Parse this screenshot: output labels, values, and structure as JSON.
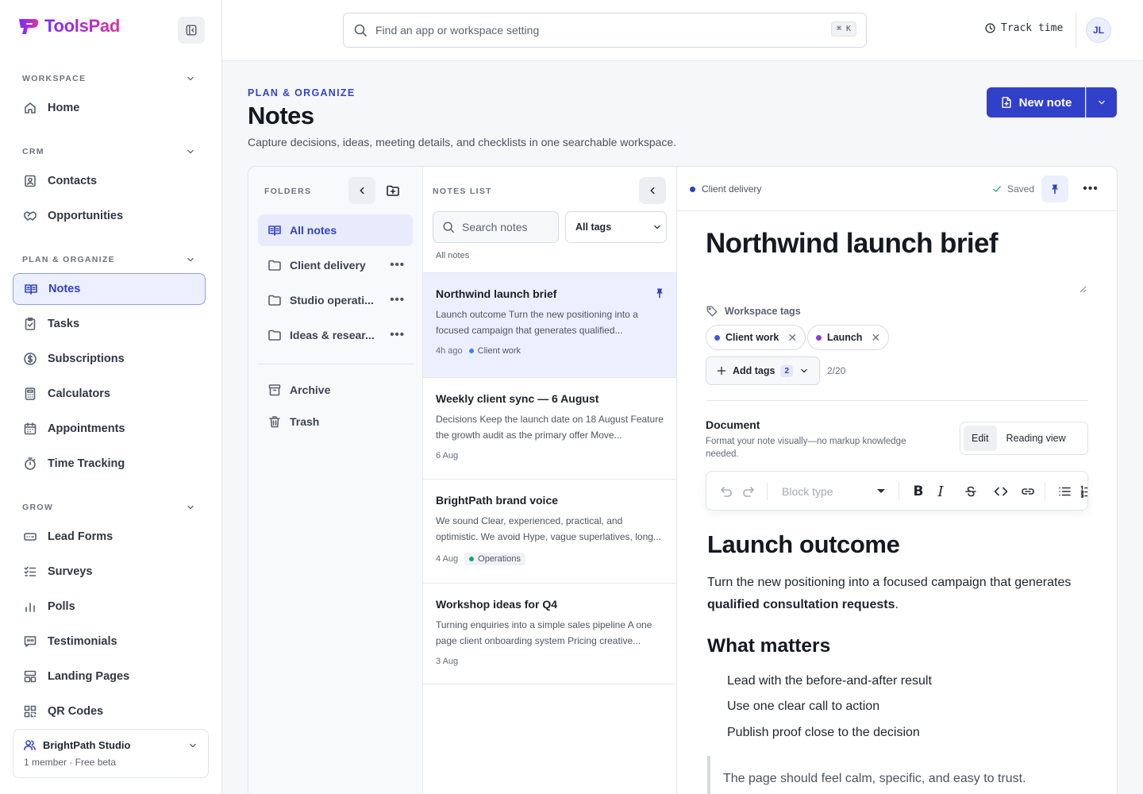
{
  "app": {
    "name": "ToolsPad"
  },
  "sidebar": {
    "sections": [
      {
        "label": "WORKSPACE"
      },
      {
        "label": "CRM"
      },
      {
        "label": "PLAN & ORGANIZE"
      },
      {
        "label": "GROW"
      }
    ],
    "items": [
      {
        "label": "Home",
        "icon": "home-icon"
      },
      {
        "label": "Contacts",
        "icon": "contacts-icon"
      },
      {
        "label": "Opportunities",
        "icon": "handshake-icon"
      },
      {
        "label": "Notes",
        "icon": "book-icon",
        "active": true
      },
      {
        "label": "Tasks",
        "icon": "clipboard-check-icon"
      },
      {
        "label": "Subscriptions",
        "icon": "dollar-circle-icon"
      },
      {
        "label": "Calculators",
        "icon": "calculator-icon"
      },
      {
        "label": "Appointments",
        "icon": "calendar-icon"
      },
      {
        "label": "Time Tracking",
        "icon": "stopwatch-icon"
      },
      {
        "label": "Lead Forms",
        "icon": "form-icon"
      },
      {
        "label": "Surveys",
        "icon": "checklist-icon"
      },
      {
        "label": "Polls",
        "icon": "bar-chart-icon"
      },
      {
        "label": "Testimonials",
        "icon": "quote-bubble-icon"
      },
      {
        "label": "Landing Pages",
        "icon": "layout-icon"
      },
      {
        "label": "QR Codes",
        "icon": "qr-icon"
      }
    ],
    "studio": {
      "name": "BrightPath Studio",
      "sub": "1 member · Free beta"
    }
  },
  "topbar": {
    "search_placeholder": "Find an app or workspace setting",
    "shortcut": "⌘ K",
    "track_label": "Track time",
    "avatar_initials": "JL"
  },
  "header": {
    "eyebrow": "PLAN & ORGANIZE",
    "title": "Notes",
    "description": "Capture decisions, ideas, meeting details, and checklists in one searchable workspace.",
    "new_note_label": "New note"
  },
  "folders": {
    "heading": "FOLDERS",
    "items": [
      {
        "label": "All notes",
        "active": true
      },
      {
        "label": "Client delivery"
      },
      {
        "label": "Studio operati..."
      },
      {
        "label": "Ideas & resear..."
      }
    ],
    "archive_label": "Archive",
    "trash_label": "Trash"
  },
  "notes_list": {
    "heading": "NOTES LIST",
    "search_placeholder": "Search notes",
    "tag_filter": "All tags",
    "scope_label": "All notes",
    "notes": [
      {
        "title": "Northwind launch brief",
        "snippet": "Launch outcome Turn the new positioning into a focused campaign that generates qualified...",
        "date": "4h ago",
        "tag": "Client work",
        "tag_color": "#3b82f6",
        "pinned": true,
        "active": true
      },
      {
        "title": "Weekly client sync — 6 August",
        "snippet": "Decisions Keep the launch date on 18 August Feature the growth audit as the primary offer Move...",
        "date": "6 Aug"
      },
      {
        "title": "BrightPath brand voice",
        "snippet": "We sound Clear, experienced, practical, and optimistic. We avoid Hype, vague superlatives, long...",
        "date": "4 Aug",
        "tag": "Operations",
        "tag_color": "#14a37f"
      },
      {
        "title": "Workshop ideas for Q4",
        "snippet": "Turning enquiries into a simple sales pipeline A one page client onboarding system Pricing creative...",
        "date": "3 Aug"
      }
    ]
  },
  "editor": {
    "folder_crumb": "Client delivery",
    "saved_label": "Saved",
    "title": "Northwind launch brief",
    "tags_label": "Workspace tags",
    "tags": [
      {
        "label": "Client work",
        "color": "#3b5bdb"
      },
      {
        "label": "Launch",
        "color": "#8b3fd1"
      }
    ],
    "add_tags_label": "Add tags",
    "add_tags_count": "2",
    "tag_limit": "2/20",
    "document_label": "Document",
    "document_desc": "Format your note visually—no markup knowledge needed.",
    "view_edit": "Edit",
    "view_reading": "Reading view",
    "block_type_placeholder": "Block type",
    "content": {
      "h1": "Launch outcome",
      "p_start": "Turn the new positioning into a focused campaign that generates ",
      "p_bold": "qualified consultation requests",
      "p_end": ".",
      "h2": "What matters",
      "bullets": [
        "Lead with the before-and-after result",
        "Use one clear call to action",
        "Publish proof close to the decision"
      ],
      "quote": "The page should feel calm, specific, and easy to trust."
    }
  },
  "colors": {
    "accent": "#3140c9",
    "active_bg": "#eceffd"
  }
}
